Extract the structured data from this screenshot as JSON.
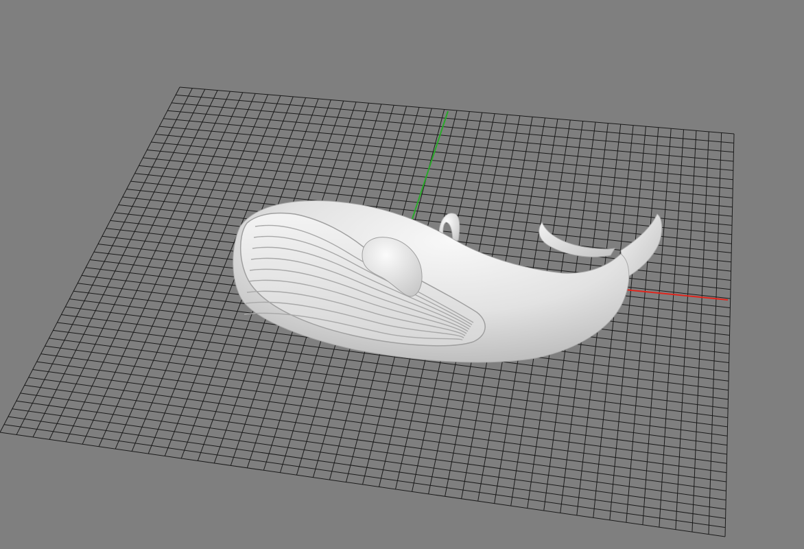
{
  "viewport": {
    "background_color": "#7f7f7f",
    "grid_line_color": "#1a1a1a",
    "grid_divisions": 44,
    "x_axis_color": "#e0251c",
    "y_axis_color": "#2aa82a",
    "model": {
      "name": "whale",
      "surface_color": "#e9e9e9",
      "shading": "smooth"
    }
  }
}
